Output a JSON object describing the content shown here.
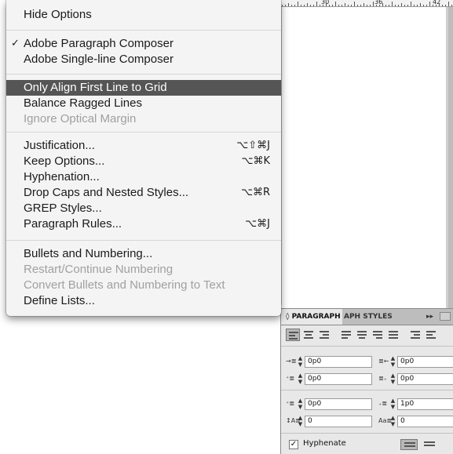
{
  "menu": {
    "items": [
      {
        "label": "Hide Options",
        "shortcut": "",
        "state": "normal"
      },
      {
        "label": "Adobe Paragraph Composer",
        "shortcut": "",
        "state": "checked"
      },
      {
        "label": "Adobe Single-line Composer",
        "shortcut": "",
        "state": "normal"
      },
      {
        "label": "Only Align First Line to Grid",
        "shortcut": "",
        "state": "highlighted"
      },
      {
        "label": "Balance Ragged Lines",
        "shortcut": "",
        "state": "normal"
      },
      {
        "label": "Ignore Optical Margin",
        "shortcut": "",
        "state": "disabled"
      },
      {
        "label": "Justification...",
        "shortcut": "⌥⇧⌘J",
        "state": "normal"
      },
      {
        "label": "Keep Options...",
        "shortcut": "⌥⌘K",
        "state": "normal"
      },
      {
        "label": "Hyphenation...",
        "shortcut": "",
        "state": "normal"
      },
      {
        "label": "Drop Caps and Nested Styles...",
        "shortcut": "⌥⌘R",
        "state": "normal"
      },
      {
        "label": "GREP Styles...",
        "shortcut": "",
        "state": "normal"
      },
      {
        "label": "Paragraph Rules...",
        "shortcut": "⌥⌘J",
        "state": "normal"
      },
      {
        "label": "Bullets and Numbering...",
        "shortcut": "",
        "state": "normal"
      },
      {
        "label": "Restart/Continue Numbering",
        "shortcut": "",
        "state": "disabled"
      },
      {
        "label": "Convert Bullets and Numbering to Text",
        "shortcut": "",
        "state": "disabled"
      },
      {
        "label": "Define Lists...",
        "shortcut": "",
        "state": "normal"
      }
    ],
    "check_glyph": "✓"
  },
  "ruler": {
    "labels": [
      "30",
      "36",
      "42"
    ]
  },
  "panel": {
    "tab_active": "◊ PARAGRAPH",
    "tab_inactive": "APH STYLES",
    "arrows": "▸▸",
    "fields": {
      "left_indent": "0p0",
      "right_indent": "0p0",
      "first_line_indent": "0p0",
      "last_line_indent": "0p0",
      "space_before": "0p0",
      "space_after": "1p0",
      "drop_cap_lines": "0",
      "drop_cap_chars": "0"
    },
    "hyphenate_label": "Hyphenate",
    "hyphenate_checked": true,
    "check_glyph": "✓"
  },
  "colors": {
    "highlight": "#555555",
    "menu_bg": "#f4f4f4",
    "disabled_text": "#a0a0a0",
    "panel_bg": "#e8e8e8"
  }
}
